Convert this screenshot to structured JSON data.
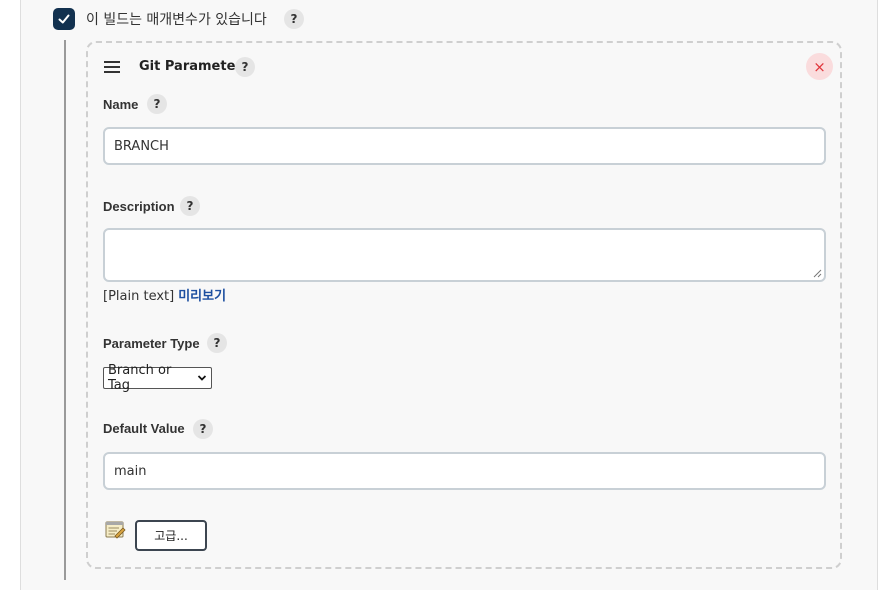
{
  "params_checkbox": {
    "label": "이 빌드는 매개변수가 있습니다",
    "checked": true,
    "help": "?"
  },
  "card": {
    "title": "Git Parameter",
    "title_help": "?",
    "delete_symbol": "×"
  },
  "name_field": {
    "label": "Name",
    "help": "?",
    "value": "BRANCH"
  },
  "description_field": {
    "label": "Description",
    "help": "?",
    "value": ""
  },
  "description_hint": {
    "format": "[Plain text]",
    "preview_link": "미리보기"
  },
  "parameter_type": {
    "label": "Parameter Type",
    "help": "?",
    "selected": "Branch or Tag"
  },
  "default_value": {
    "label": "Default Value",
    "help": "?",
    "value": "main"
  },
  "advanced_button": {
    "label": "고급..."
  },
  "colors": {
    "checkbox": "#12314f",
    "link": "#1d4fa0",
    "delete": "#e0353b"
  }
}
